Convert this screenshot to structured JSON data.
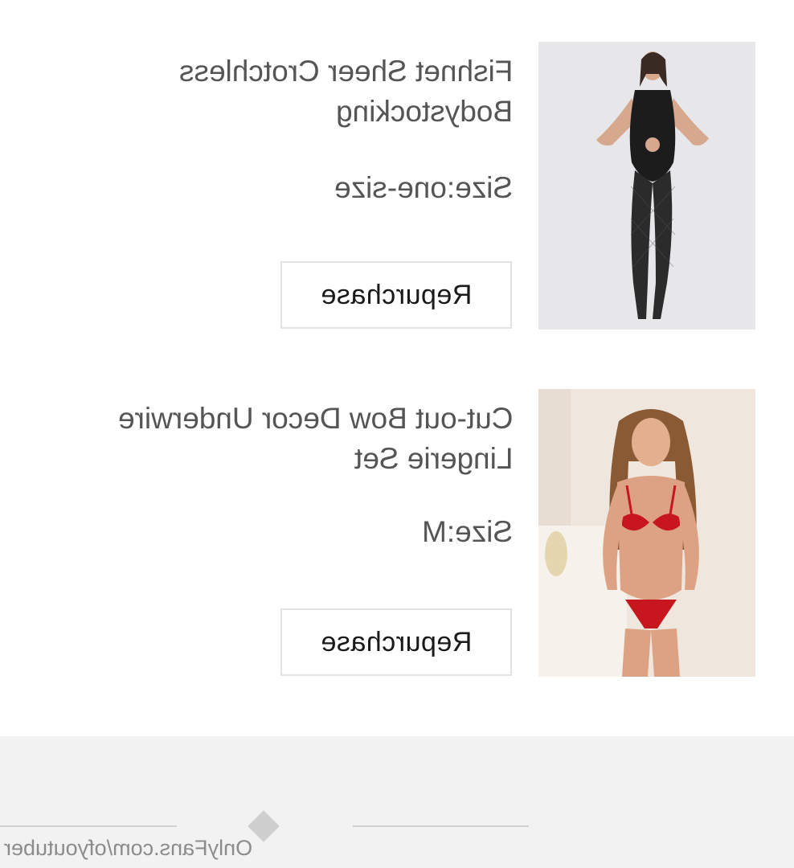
{
  "items": [
    {
      "title_line1": "Fishnet Sheer Crotchless",
      "title_line2": "Bodystocking",
      "size": "Size:one-size",
      "button_label": "Repurchase"
    },
    {
      "title_line1": "Cut-out Bow Decor Underwire",
      "title_line2": "Lingerie Set",
      "size": "Size:M",
      "button_label": "Repurchase"
    }
  ],
  "footer": {
    "watermark": "OnlyFans.com/ofyoutuber"
  },
  "colors": {
    "background": "#ffffff",
    "text_muted": "#555555",
    "button_text": "#1a1a1a",
    "button_border": "#e2e2e2",
    "footer_bg": "#f2f2f2"
  }
}
